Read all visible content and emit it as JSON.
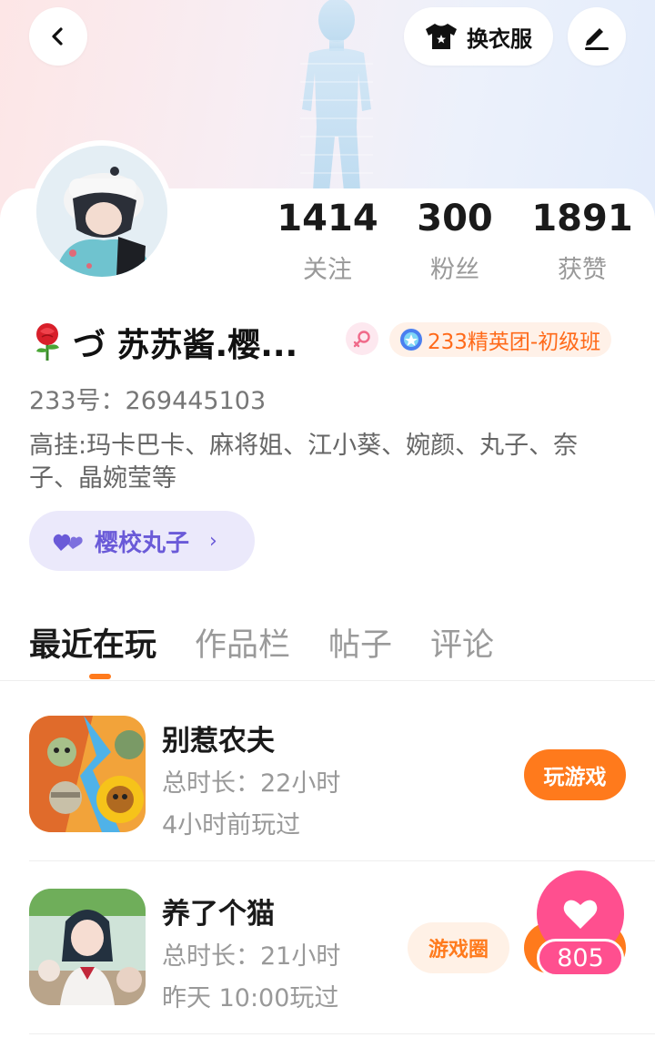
{
  "header": {
    "dress_label": "换衣服"
  },
  "stats": [
    {
      "value": "1414",
      "label": "关注"
    },
    {
      "value": "300",
      "label": "粉丝"
    },
    {
      "value": "1891",
      "label": "获赞"
    }
  ],
  "profile": {
    "name": "づ 苏苏酱.樱...",
    "club_badge": "233精英团-初级班",
    "uid": "233号：269445103",
    "bio": "高挂:玛卡巴卡、麻将姐、江小葵、婉颜、丸子、奈子、晶婉莹等",
    "tag": "樱校丸子"
  },
  "tabs": [
    {
      "label": "最近在玩",
      "active": true
    },
    {
      "label": "作品栏",
      "active": false
    },
    {
      "label": "帖子",
      "active": false
    },
    {
      "label": "评论",
      "active": false
    }
  ],
  "games": [
    {
      "title": "别惹农夫",
      "duration": "总时长：22小时",
      "last_played": "4小时前玩过",
      "play_label": "玩游戏"
    },
    {
      "title": "养了个猫",
      "duration": "总时长：21小时",
      "last_played": "昨天 10:00玩过",
      "circle_label": "游戏圈"
    }
  ],
  "like": {
    "count": "805"
  },
  "colors": {
    "accent": "#ff7a1c",
    "like_pink": "#ff4f8f",
    "tag_purple": "#6a5ad8"
  }
}
